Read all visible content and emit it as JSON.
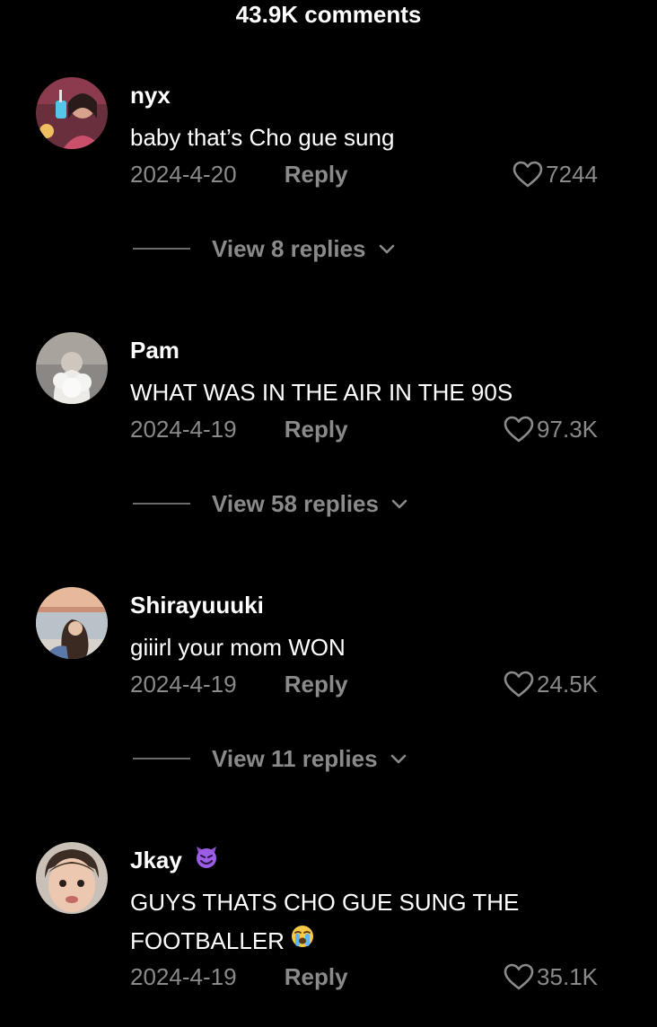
{
  "header": {
    "comment_count": "43.9K comments"
  },
  "comments": [
    {
      "username": "nyx",
      "text": "baby that’s Cho gue sung",
      "date": "2024-4-20",
      "reply_label": "Reply",
      "likes": "7244",
      "view_replies": "View 8 replies"
    },
    {
      "username": "Pam",
      "text": "WHAT WAS IN THE AIR IN THE 90S",
      "date": "2024-4-19",
      "reply_label": "Reply",
      "likes": "97.3K",
      "view_replies": "View 58 replies"
    },
    {
      "username": "Shirayuuuki",
      "text": "giiirl your mom WON",
      "date": "2024-4-19",
      "reply_label": "Reply",
      "likes": "24.5K",
      "view_replies": "View 11 replies"
    },
    {
      "username": "Jkay",
      "username_emoji": "smiling-devil-emoji",
      "text_line1": "GUYS THATS CHO GUE SUNG THE",
      "text_line2": "FOOTBALLER",
      "text_emoji": "crying-face-emoji",
      "date": "2024-4-19",
      "reply_label": "Reply",
      "likes": "35.1K"
    }
  ],
  "colors": {
    "background": "#000000",
    "primary_text": "#ffffff",
    "secondary_text": "#8a8a8a",
    "divider": "#6a6a6a"
  },
  "icons": {
    "like": "heart-outline-icon",
    "expand": "chevron-down-icon"
  }
}
